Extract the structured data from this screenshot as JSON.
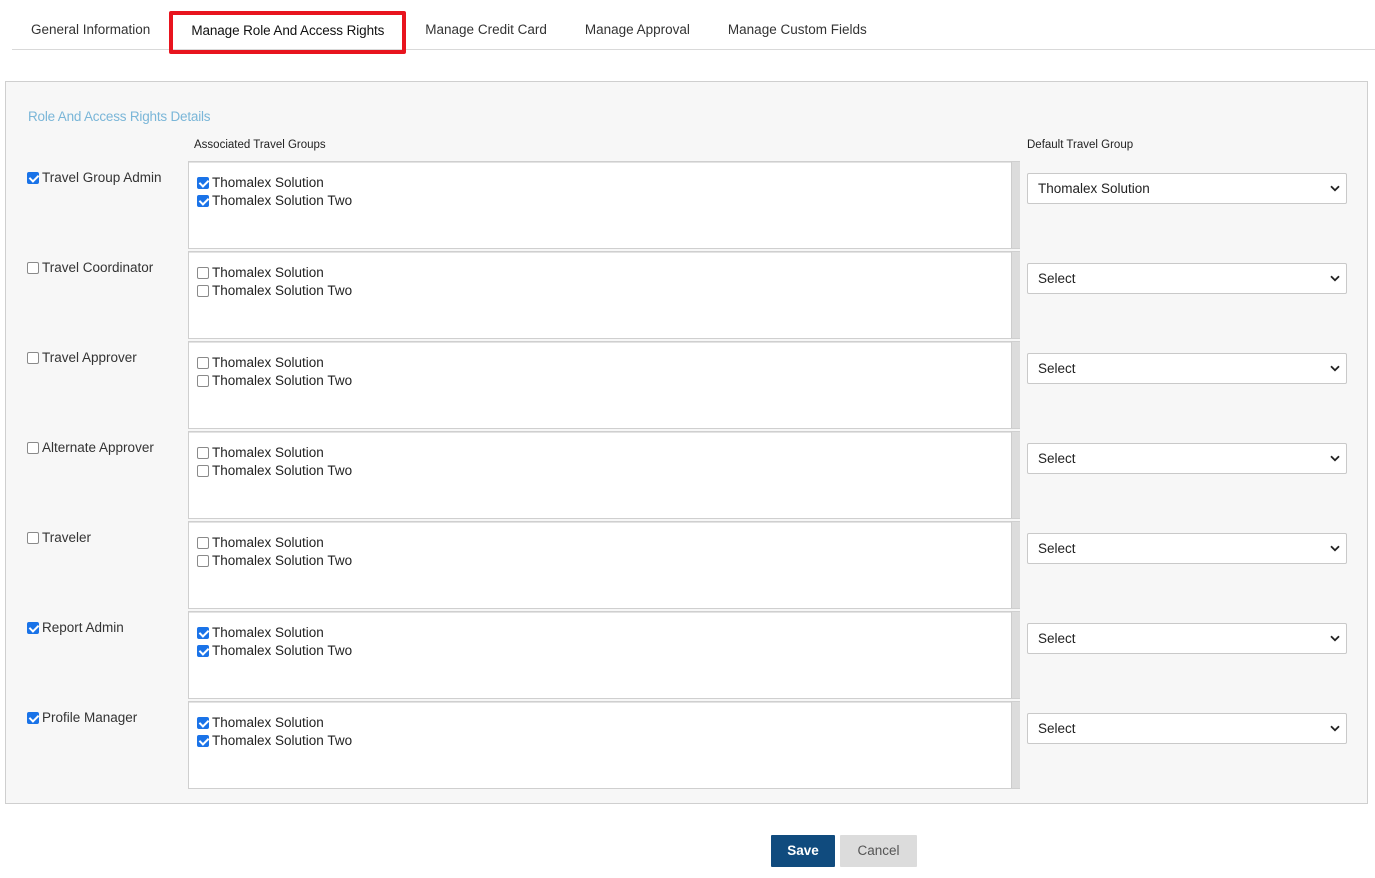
{
  "tabs": [
    {
      "label": "General Information",
      "active": false
    },
    {
      "label": "Manage Role And Access Rights",
      "active": true
    },
    {
      "label": "Manage Credit Card",
      "active": false
    },
    {
      "label": "Manage Approval",
      "active": false
    },
    {
      "label": "Manage Custom Fields",
      "active": false
    }
  ],
  "panel": {
    "section_title": "Role And Access Rights Details",
    "col_groups_header": "Associated Travel Groups",
    "col_default_header": "Default Travel Group",
    "rows": [
      {
        "role": "Travel Group Admin",
        "checked": true,
        "groups": [
          {
            "label": "Thomalex Solution",
            "checked": true
          },
          {
            "label": "Thomalex Solution Two",
            "checked": true
          }
        ],
        "default": "Thomalex Solution"
      },
      {
        "role": "Travel Coordinator",
        "checked": false,
        "groups": [
          {
            "label": "Thomalex Solution",
            "checked": false
          },
          {
            "label": "Thomalex Solution Two",
            "checked": false
          }
        ],
        "default": "Select"
      },
      {
        "role": "Travel Approver",
        "checked": false,
        "groups": [
          {
            "label": "Thomalex Solution",
            "checked": false
          },
          {
            "label": "Thomalex Solution Two",
            "checked": false
          }
        ],
        "default": "Select"
      },
      {
        "role": "Alternate Approver",
        "checked": false,
        "groups": [
          {
            "label": "Thomalex Solution",
            "checked": false
          },
          {
            "label": "Thomalex Solution Two",
            "checked": false
          }
        ],
        "default": "Select"
      },
      {
        "role": "Traveler",
        "checked": false,
        "groups": [
          {
            "label": "Thomalex Solution",
            "checked": false
          },
          {
            "label": "Thomalex Solution Two",
            "checked": false
          }
        ],
        "default": "Select"
      },
      {
        "role": "Report Admin",
        "checked": true,
        "groups": [
          {
            "label": "Thomalex Solution",
            "checked": true
          },
          {
            "label": "Thomalex Solution Two",
            "checked": true
          }
        ],
        "default": "Select"
      },
      {
        "role": "Profile Manager",
        "checked": true,
        "groups": [
          {
            "label": "Thomalex Solution",
            "checked": true
          },
          {
            "label": "Thomalex Solution Two",
            "checked": true
          }
        ],
        "default": "Select"
      }
    ]
  },
  "buttons": {
    "save": "Save",
    "cancel": "Cancel"
  },
  "colors": {
    "accent": "#104b7e",
    "highlight_border": "#e8141e",
    "section_title": "#7ab6d8",
    "checkbox": "#1a73e8"
  },
  "icons": {
    "select_arrow": "chevron-down-icon",
    "checkbox": "checkbox-icon"
  }
}
